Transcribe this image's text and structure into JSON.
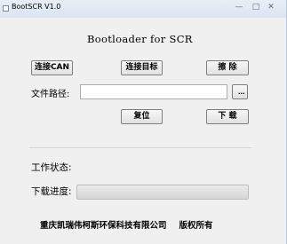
{
  "window": {
    "title": "BootSCR V1.0",
    "controls": {
      "minimize": "—",
      "maximize": "□",
      "close": "✕"
    }
  },
  "main": {
    "heading": "Bootloader for SCR",
    "buttons": {
      "connect_can": "连接CAN",
      "connect_target": "连接目标",
      "erase": "擦  除",
      "reset": "复位",
      "download": "下  载",
      "browse": "..."
    },
    "file_path": {
      "label": "文件路径:",
      "value": ""
    },
    "status": {
      "label": "工作状态:",
      "value": ""
    },
    "progress": {
      "label": "下载进度:",
      "percent": 0
    }
  },
  "footer": {
    "company": "重庆凯瑞伟柯斯环保科技有限公司",
    "rights": "版权所有"
  },
  "colors": {
    "progress_fill": "#06b025",
    "title_bar": "#dbe5f1"
  }
}
